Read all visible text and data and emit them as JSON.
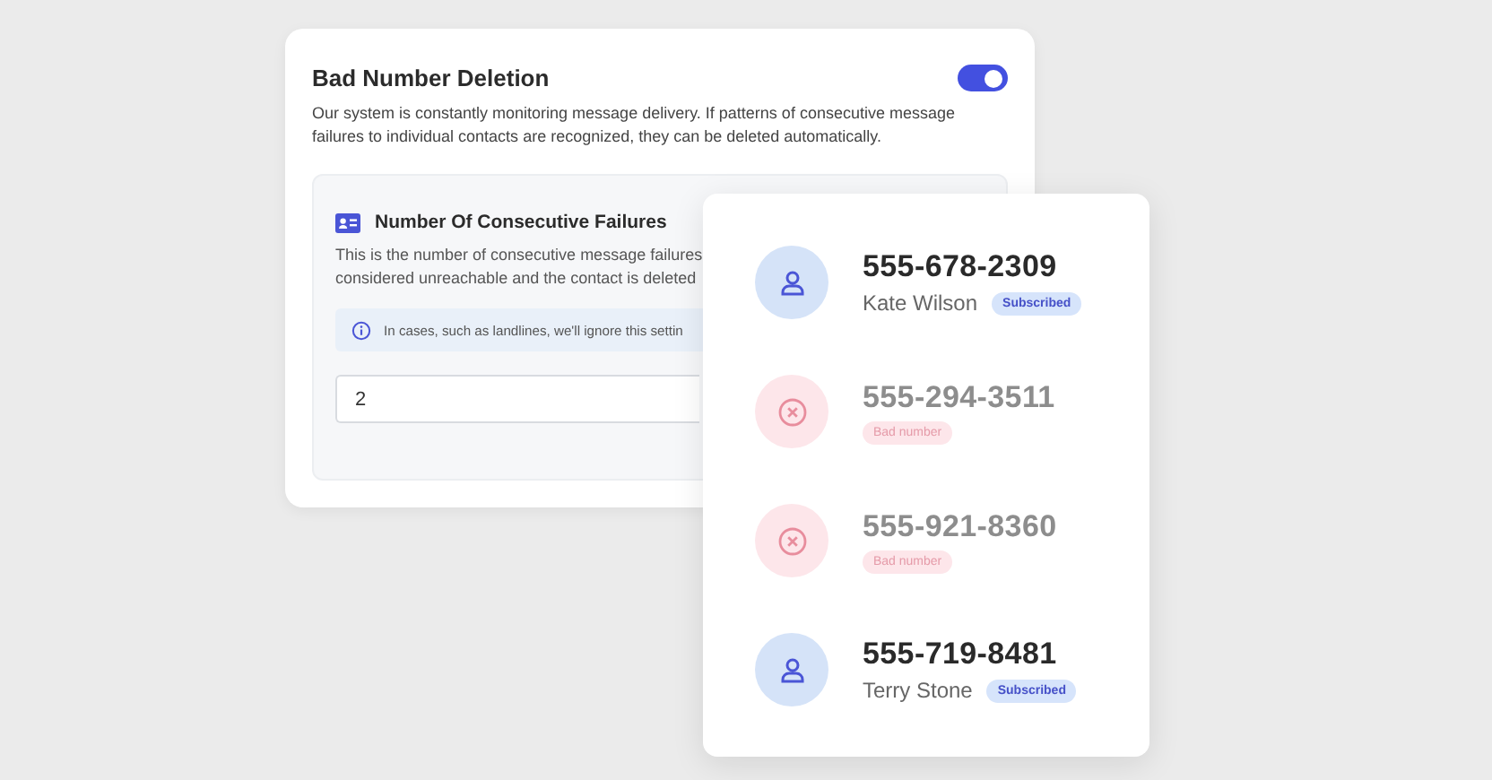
{
  "settings_card": {
    "title": "Bad Number Deletion",
    "toggle_on": true,
    "description": "Our system is constantly monitoring message delivery. If patterns of consecutive message failures to individual contacts are recognized, they can be deleted automatically.",
    "section": {
      "title": "Number Of Consecutive Failures",
      "description_lines": [
        "This is the number of consecutive message failures",
        "considered unreachable and the contact is deleted"
      ],
      "info": "In cases, such as landlines, we'll ignore this settin",
      "value": "2"
    }
  },
  "contacts": [
    {
      "kind": "subscribed",
      "phone": "555-678-2309",
      "name": "Kate Wilson",
      "badge": "Subscribed"
    },
    {
      "kind": "bad",
      "phone": "555-294-3511",
      "badge": "Bad number"
    },
    {
      "kind": "bad",
      "phone": "555-921-8360",
      "badge": "Bad number"
    },
    {
      "kind": "subscribed",
      "phone": "555-719-8481",
      "name": "Terry Stone",
      "badge": "Subscribed"
    }
  ]
}
